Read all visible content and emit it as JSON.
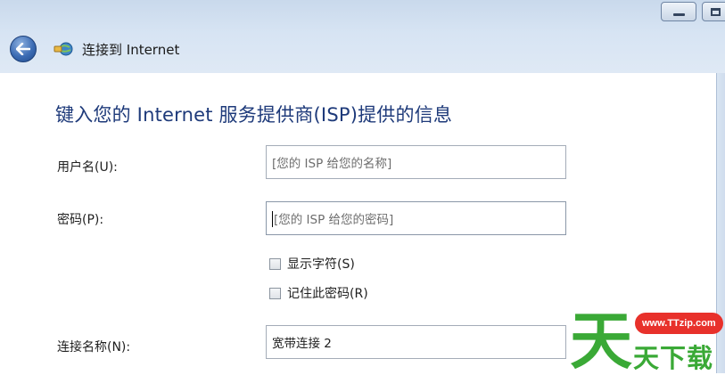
{
  "window": {
    "title": "连接到 Internet"
  },
  "icons": {
    "back": "back-arrow-icon",
    "network": "network-connection-icon",
    "minimize": "minimize-icon",
    "maximize": "maximize-icon"
  },
  "form": {
    "heading": "键入您的 Internet 服务提供商(ISP)提供的信息",
    "username": {
      "label": "用户名(U):",
      "value": "",
      "placeholder": "[您的 ISP 给您的名称]"
    },
    "password": {
      "label": "密码(P):",
      "value": "",
      "placeholder": "[您的 ISP 给您的密码]"
    },
    "show_chars": {
      "label": "显示字符(S)",
      "checked": false
    },
    "remember_password": {
      "label": "记住此密码(R)",
      "checked": false
    },
    "connection_name": {
      "label": "连接名称(N):",
      "value": "宽带连接 2"
    }
  },
  "watermark": {
    "url": "www.TTzip.com",
    "text": "天下载",
    "logo_char": "天"
  },
  "colors": {
    "heading": "#1e3a7a",
    "chrome": "#d7e4f3",
    "logo_green": "#3aa936",
    "logo_red": "#e8312b"
  }
}
